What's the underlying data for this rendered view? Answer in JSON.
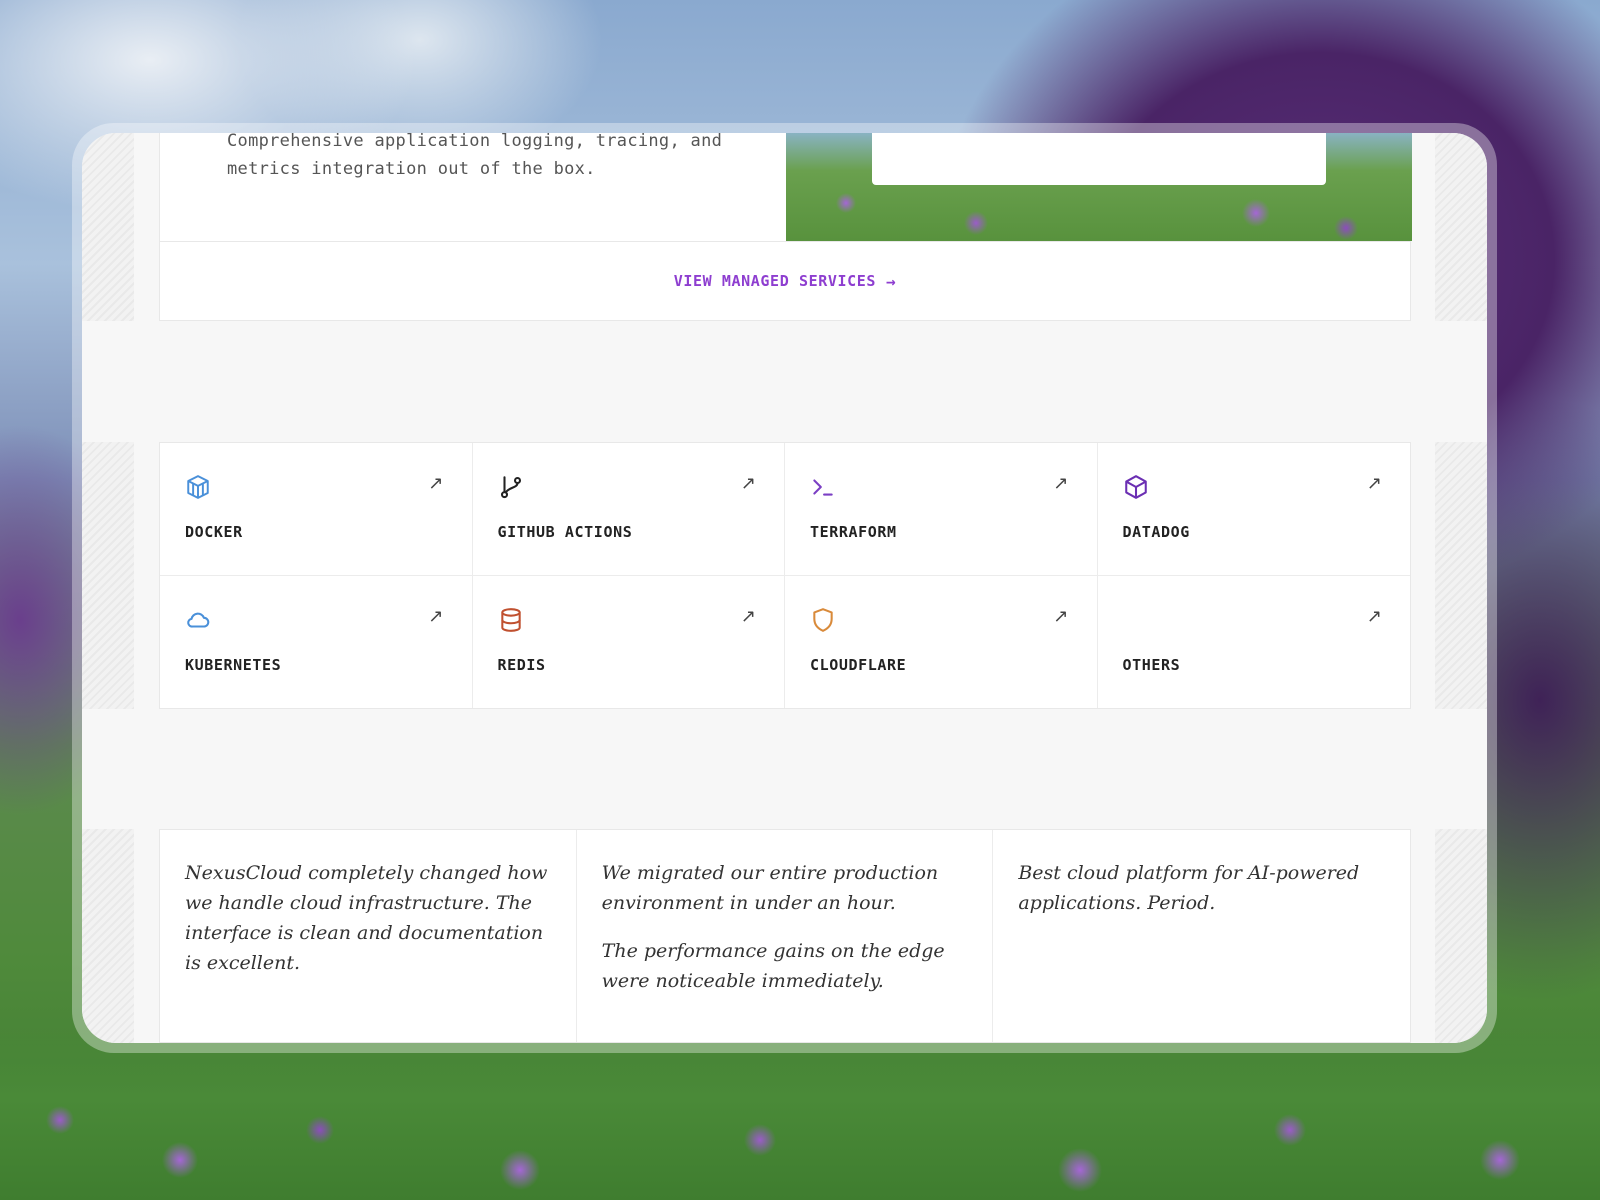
{
  "feature": {
    "description": "Comprehensive application logging, tracing, and metrics integration out of the box."
  },
  "services_link": {
    "label": "VIEW MANAGED SERVICES",
    "arrow": "→"
  },
  "integrations": [
    {
      "label": "DOCKER",
      "icon": "docker-icon",
      "color": "#4a90d9"
    },
    {
      "label": "GITHUB ACTIONS",
      "icon": "git-branch-icon",
      "color": "#222222"
    },
    {
      "label": "TERRAFORM",
      "icon": "terminal-icon",
      "color": "#7b3fc4"
    },
    {
      "label": "DATADOG",
      "icon": "package-icon",
      "color": "#6b2fb3"
    },
    {
      "label": "KUBERNETES",
      "icon": "cloud-icon",
      "color": "#4a90d9"
    },
    {
      "label": "REDIS",
      "icon": "database-icon",
      "color": "#c0502f"
    },
    {
      "label": "CLOUDFLARE",
      "icon": "shield-icon",
      "color": "#d98a3a"
    },
    {
      "label": "OTHERS",
      "icon": "",
      "color": ""
    }
  ],
  "tile_arrow": "↗",
  "testimonials": [
    {
      "paragraphs": [
        "NexusCloud completely changed how we handle cloud infrastructure. The interface is clean and documentation is excellent."
      ]
    },
    {
      "paragraphs": [
        "We migrated our entire production environment in under an hour.",
        "The performance gains on the edge were noticeable immediately."
      ]
    },
    {
      "paragraphs": [
        "Best cloud platform for AI-powered applications. Period."
      ]
    }
  ]
}
